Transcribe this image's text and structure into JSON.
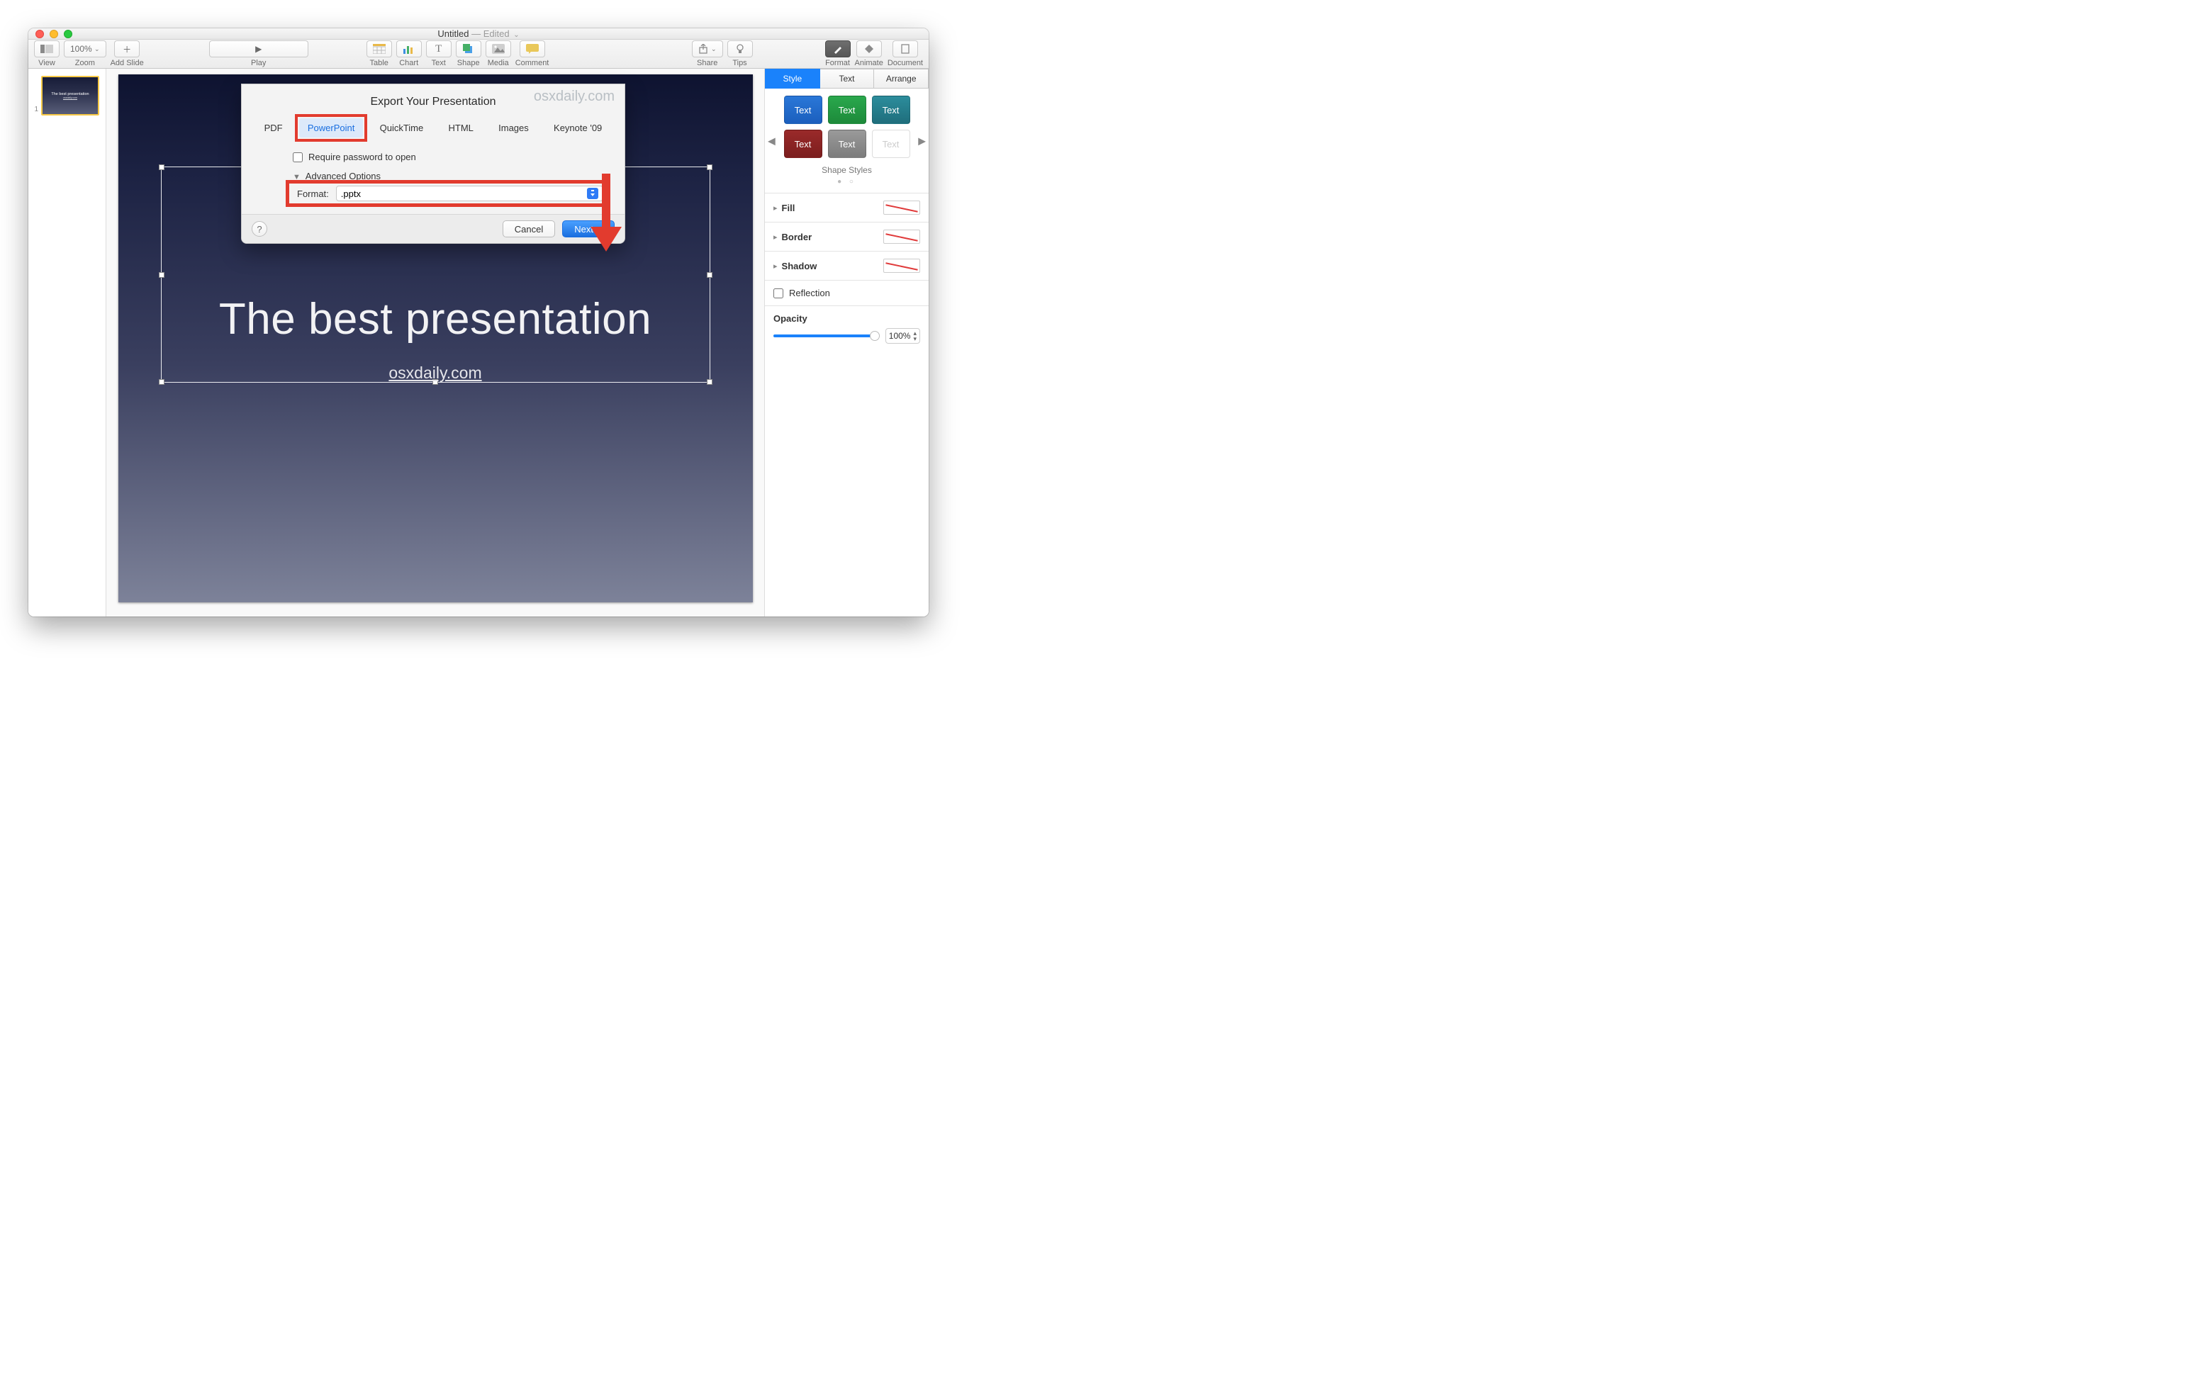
{
  "window": {
    "title": "Untitled",
    "edited": "— Edited"
  },
  "toolbar": {
    "view": "View",
    "zoom_value": "100%",
    "zoom": "Zoom",
    "add_slide": "Add Slide",
    "play": "Play",
    "table": "Table",
    "chart": "Chart",
    "text": "Text",
    "shape": "Shape",
    "media": "Media",
    "comment": "Comment",
    "share": "Share",
    "tips": "Tips",
    "format": "Format",
    "animate": "Animate",
    "document": "Document"
  },
  "navigator": {
    "slide_number": "1",
    "thumb_title": "The best presentation",
    "thumb_sub": "osxdaily.com"
  },
  "slide": {
    "title": "The best presentation",
    "subtitle": "osxdaily.com"
  },
  "export": {
    "watermark": "osxdaily.com",
    "title": "Export Your Presentation",
    "tabs": {
      "pdf": "PDF",
      "powerpoint": "PowerPoint",
      "quicktime": "QuickTime",
      "html": "HTML",
      "images": "Images",
      "keynote09": "Keynote '09"
    },
    "require_password": "Require password to open",
    "advanced_options": "Advanced Options",
    "format_label": "Format:",
    "format_value": ".pptx",
    "help": "?",
    "cancel": "Cancel",
    "next": "Next…"
  },
  "inspector": {
    "tabs": {
      "style": "Style",
      "text": "Text",
      "arrange": "Arrange"
    },
    "style_cell": "Text",
    "shape_styles": "Shape Styles",
    "fill": "Fill",
    "border": "Border",
    "shadow": "Shadow",
    "reflection": "Reflection",
    "opacity": "Opacity",
    "opacity_value": "100%"
  }
}
